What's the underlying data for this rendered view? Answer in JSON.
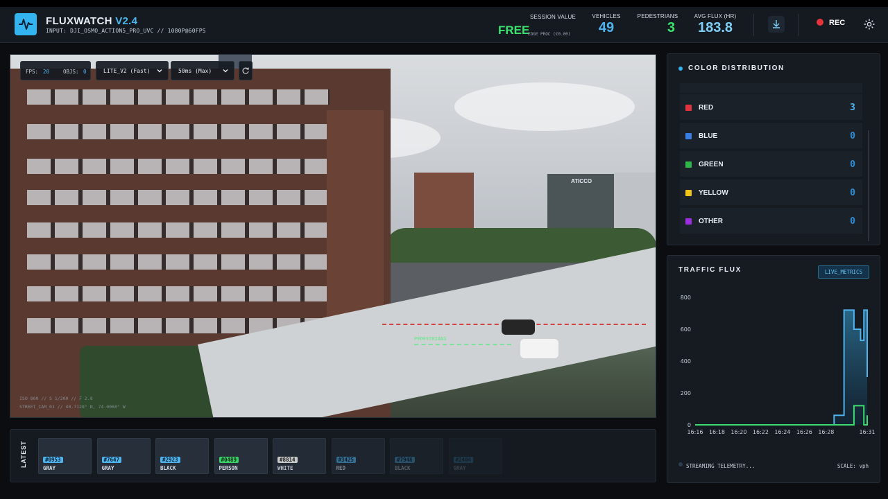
{
  "app": {
    "title": "FLUXWATCH",
    "version": "V2.4",
    "input": "INPUT: DJI_OSMO_ACTION5_PRO_UVC // 1080P@60FPS"
  },
  "stats": {
    "session_label": "SESSION VALUE",
    "session_value": "FREE",
    "session_sub": "EDGE PROC (€0.00)",
    "vehicles_label": "VEHICLES",
    "vehicles_value": "49",
    "pedestrians_label": "PEDESTRIANS",
    "pedestrians_value": "3",
    "avgflux_label": "AVG FLUX (HR)",
    "avgflux_value": "183.8"
  },
  "controls": {
    "rec_label": "REC",
    "download_icon": "download-icon",
    "settings_icon": "gear-icon"
  },
  "video": {
    "fps_label": "FPS:",
    "fps_value": "20",
    "objs_label": "OBJS:",
    "objs_value": "0",
    "model_select": "LITE_V2 (Fast)",
    "latency_select": "50ms (Max)",
    "pedestrians_zone": "PEDESTRIANS",
    "hud_line1": "ISO 800 // S 1/200 // F 2.8",
    "hud_line2": "STREET_CAM_01 // 40.7128° N, 74.0060° W",
    "sign_text": "ATICCO"
  },
  "color_distribution": {
    "title": "COLOR DISTRIBUTION",
    "items": [
      {
        "name": "RED",
        "value": "3",
        "color": "#e0323f",
        "value_color": "#4fb3ee"
      },
      {
        "name": "BLUE",
        "value": "0",
        "color": "#3a7de3",
        "value_color": "#2f8ed8"
      },
      {
        "name": "GREEN",
        "value": "0",
        "color": "#2fb54a",
        "value_color": "#2f8ed8"
      },
      {
        "name": "YELLOW",
        "value": "0",
        "color": "#f2c318",
        "value_color": "#2f8ed8"
      },
      {
        "name": "OTHER",
        "value": "0",
        "color": "#9b2fe0",
        "value_color": "#2f8ed8"
      }
    ]
  },
  "traffic_flux": {
    "title": "TRAFFIC FLUX",
    "badge": "LIVE_METRICS",
    "footer": "STREAMING TELEMETRY...",
    "scale": "SCALE: vph"
  },
  "chart_data": {
    "type": "area",
    "title": "TRAFFIC FLUX",
    "x_ticks": [
      "16:16",
      "16:18",
      "16:20",
      "16:22",
      "16:24",
      "16:26",
      "16:28",
      "16:31"
    ],
    "y_ticks": [
      0,
      200,
      400,
      600,
      800
    ],
    "ylim": [
      0,
      800
    ],
    "series": [
      {
        "x": [
          0,
          20.5,
          21.0,
          22.0,
          22.5,
          23.5,
          24.0,
          25.0,
          25.5,
          26.0
        ],
        "values": [
          0,
          0,
          60,
          60,
          720,
          720,
          600,
          530,
          720,
          300
        ],
        "color": "#4fb3ee"
      },
      {
        "x": [
          0,
          20.5,
          21.0,
          22.0,
          22.5,
          23.5,
          24.0,
          25.0,
          25.5,
          26.0
        ],
        "values": [
          0,
          0,
          0,
          0,
          0,
          0,
          120,
          120,
          0,
          60
        ],
        "color": "#3ddc6e"
      }
    ],
    "grid": false
  },
  "latest": {
    "label": "LATEST",
    "cards": [
      {
        "id": "#0953",
        "type": "GRAY",
        "badge": "#4fb3ee",
        "text": "#0b2030",
        "opacity": 1
      },
      {
        "id": "#7647",
        "type": "GRAY",
        "badge": "#4fb3ee",
        "text": "#0b2030",
        "opacity": 1
      },
      {
        "id": "#2923",
        "type": "BLACK",
        "badge": "#4fb3ee",
        "text": "#0b2030",
        "opacity": 1
      },
      {
        "id": "#0489",
        "type": "PERSON",
        "badge": "#39d06a",
        "text": "#0b2a14",
        "opacity": 1
      },
      {
        "id": "#8814",
        "type": "WHITE",
        "badge": "#e8e8e8",
        "text": "#1a1a1a",
        "opacity": 0.85
      },
      {
        "id": "#3425",
        "type": "RED",
        "badge": "#4fb3ee",
        "text": "#0b2030",
        "opacity": 0.55
      },
      {
        "id": "#7948",
        "type": "BLACK",
        "badge": "#4fb3ee",
        "text": "#0b2030",
        "opacity": 0.35
      },
      {
        "id": "#2404",
        "type": "GRAY",
        "badge": "#4fb3ee",
        "text": "#0b2030",
        "opacity": 0.2
      }
    ]
  }
}
